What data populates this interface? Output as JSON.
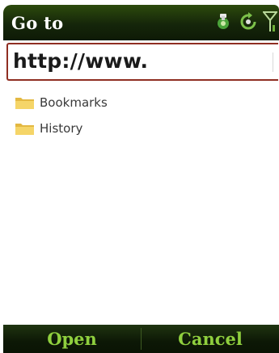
{
  "title_bar": {
    "title": "Go to",
    "status_icons": [
      "sync-icon",
      "refresh-icon",
      "signal-icon"
    ]
  },
  "address_bar": {
    "value": "http://www."
  },
  "list": {
    "items": [
      {
        "label": "Bookmarks",
        "icon": "folder-icon"
      },
      {
        "label": "History",
        "icon": "folder-icon"
      }
    ]
  },
  "softkeys": {
    "left": "Open",
    "right": "Cancel"
  },
  "colors": {
    "title_bar_bg": "#15260a",
    "title_text": "#ffffff",
    "softkey_text": "#8fcf3e",
    "address_border": "#8f2e22",
    "folder_yellow": "#f2cf55"
  }
}
